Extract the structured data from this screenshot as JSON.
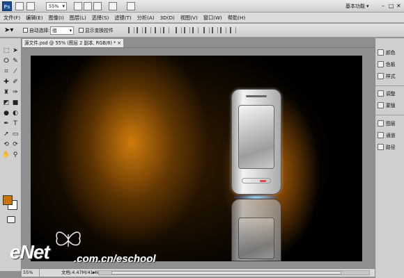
{
  "app": {
    "logo": "Ps",
    "zoom": "55%",
    "workspace": "基本功能",
    "window_buttons": [
      "–",
      "□",
      "✕"
    ],
    "colors": {
      "foreground": "#c7750b",
      "background": "#ffffff"
    }
  },
  "menu": [
    "文件(F)",
    "编辑(E)",
    "图像(I)",
    "图层(L)",
    "选择(S)",
    "滤镜(T)",
    "分析(A)",
    "3D(D)",
    "视图(V)",
    "窗口(W)",
    "帮助(H)"
  ],
  "options": {
    "auto_select_label": "自动选择:",
    "auto_select_value": "组",
    "show_transform_label": "显示变换控件"
  },
  "tools": [
    "move-tool-icon",
    "marquee-tool-icon",
    "lasso-tool-icon",
    "quick-select-icon",
    "crop-tool-icon",
    "eyedropper-icon",
    "healing-brush-icon",
    "brush-icon",
    "clone-stamp-icon",
    "history-brush-icon",
    "eraser-icon",
    "gradient-icon",
    "blur-icon",
    "dodge-icon",
    "pen-icon",
    "type-icon",
    "path-select-icon",
    "shape-icon",
    "3d-rotate-icon",
    "3d-orbit-icon",
    "hand-icon",
    "zoom-icon"
  ],
  "document": {
    "tab_title": "源文件.psd @ 55% (图层 2 副本, RGB/8) *",
    "close": "×"
  },
  "status": {
    "zoom": "55%",
    "doc_info": "文档:4.47M/41.6M"
  },
  "panels": [
    {
      "label": "颜色",
      "icon": "color-icon"
    },
    {
      "label": "色板",
      "icon": "swatches-icon"
    },
    {
      "label": "样式",
      "icon": "styles-icon"
    },
    {
      "label": "调整",
      "icon": "adjustments-icon"
    },
    {
      "label": "蒙版",
      "icon": "masks-icon"
    },
    {
      "label": "图层",
      "icon": "layers-icon"
    },
    {
      "label": "通道",
      "icon": "channels-icon"
    },
    {
      "label": "路径",
      "icon": "paths-icon"
    }
  ],
  "watermark": {
    "brand": "eNet",
    "url": ".com.cn/eschool"
  }
}
